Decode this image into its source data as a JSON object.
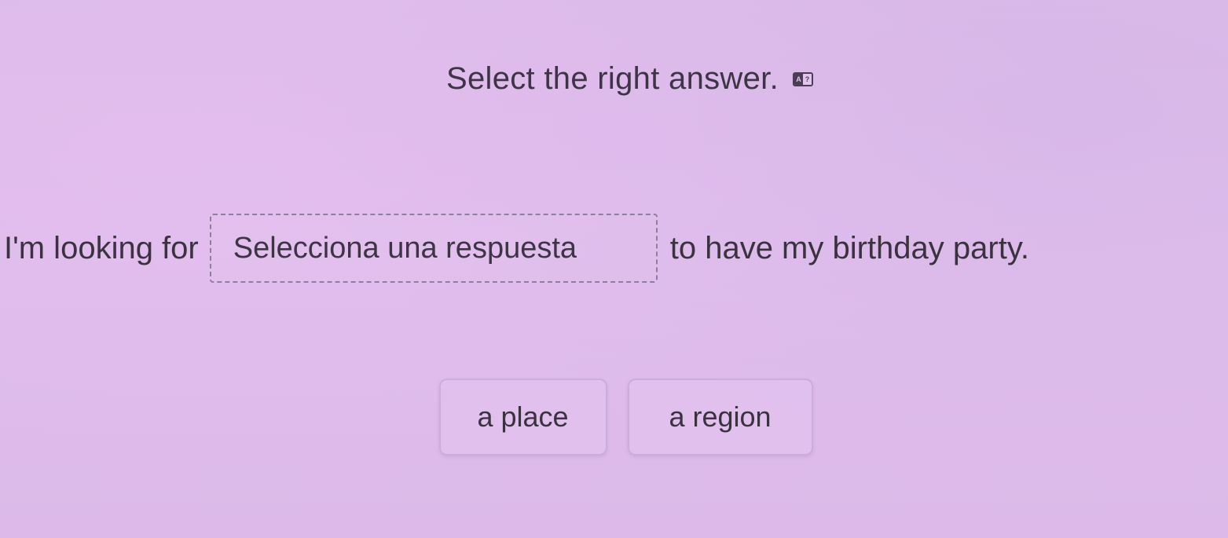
{
  "instruction": {
    "text": "Select the right answer.",
    "translate_icon_left": "A",
    "translate_icon_right": "?"
  },
  "sentence": {
    "prefix": "I'm looking for",
    "blank_placeholder": "Selecciona una respuesta",
    "suffix": "to have my birthday party."
  },
  "options": [
    {
      "label": "a place"
    },
    {
      "label": "a region"
    }
  ]
}
